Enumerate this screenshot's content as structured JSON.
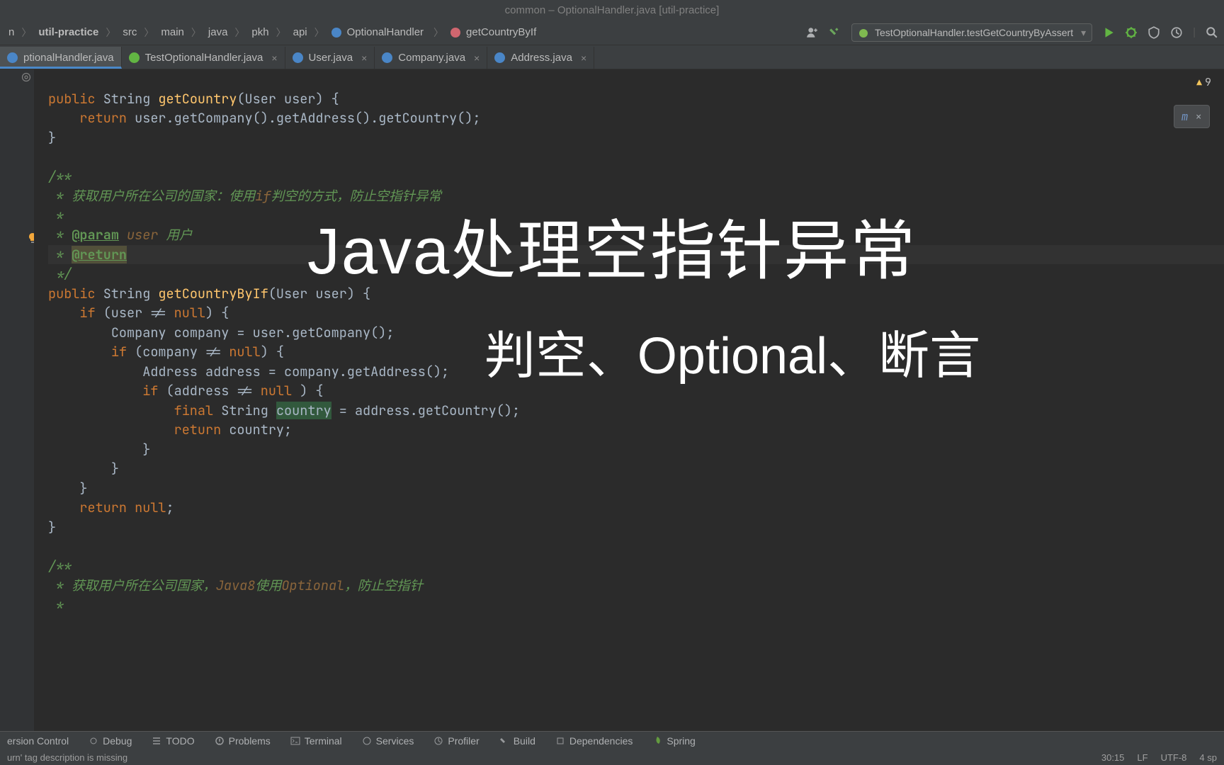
{
  "title": "common – OptionalHandler.java [util-practice]",
  "breadcrumb": [
    "n",
    "util-practice",
    "src",
    "main",
    "java",
    "pkh",
    "api",
    "OptionalHandler",
    "getCountryByIf"
  ],
  "run_config": "TestOptionalHandler.testGetCountryByAssert",
  "tabs": [
    {
      "label": "ptionalHandler.java",
      "active": true
    },
    {
      "label": "TestOptionalHandler.java",
      "active": false
    },
    {
      "label": "User.java",
      "active": false
    },
    {
      "label": "Company.java",
      "active": false
    },
    {
      "label": "Address.java",
      "active": false
    }
  ],
  "warnings": "9",
  "mini_widget": "m",
  "overlay": {
    "line1": "Java处理空指针异常",
    "line2": "判空、Optional、断言"
  },
  "code": {
    "l1_kw": "public",
    "l1_type": " String ",
    "l1_meth": "getCountry",
    "l1_sig": "(User user) {",
    "l2_kw": "return",
    "l2_rest": " user.getCompany().getAddress().getCountry();",
    "l3": "}",
    "l5": "/**",
    "l6a": " * 获取用户所在公司的国家：使用",
    "l6b": "if",
    "l6c": "判空的方式，防止空指针异常",
    "l7": " *",
    "l8a": " * ",
    "l8tag": "@param",
    "l8p": " user",
    "l8rest": " 用户",
    "l9a": " * ",
    "l9tag": "@return",
    "l10": " */",
    "l11kw": "public",
    "l11type": " String ",
    "l11meth": "getCountryByIf",
    "l11sig": "(User user) {",
    "l12kw": "if",
    "l12rest": " (user != ",
    "l12null": "null",
    "l12end": ") {",
    "l13": "Company company = user.getCompany();",
    "l14kw": "if",
    "l14rest": " (company != ",
    "l14null": "null",
    "l14end": ") {",
    "l15": "Address address = company.getAddress();",
    "l16kw": "if",
    "l16rest": " (address != ",
    "l16null": "null",
    "l16end": " ) {",
    "l17kw": "final",
    "l17rest": " String ",
    "l17sel": "country",
    "l17end": " = address.getCountry();",
    "l18kw": "return",
    "l18rest": " country;",
    "l19": "}",
    "l20": "}",
    "l21": "}",
    "l22kw": "return",
    "l22null": " null",
    "l22end": ";",
    "l23": "}",
    "l25": "/**",
    "l26a": " * 获取用户所在公司国家，",
    "l26b": "Java8",
    "l26c": "使用",
    "l26d": "Optional",
    "l26e": "，防止空指针",
    "l27": " *"
  },
  "bottom": {
    "version_control": "ersion Control",
    "debug": "Debug",
    "todo": "TODO",
    "problems": "Problems",
    "terminal": "Terminal",
    "services": "Services",
    "profiler": "Profiler",
    "build": "Build",
    "dependencies": "Dependencies",
    "spring": "Spring"
  },
  "status": {
    "left": "urn' tag description is missing",
    "pos": "30:15",
    "sep": "LF",
    "enc": "UTF-8",
    "indent": "4 sp"
  }
}
